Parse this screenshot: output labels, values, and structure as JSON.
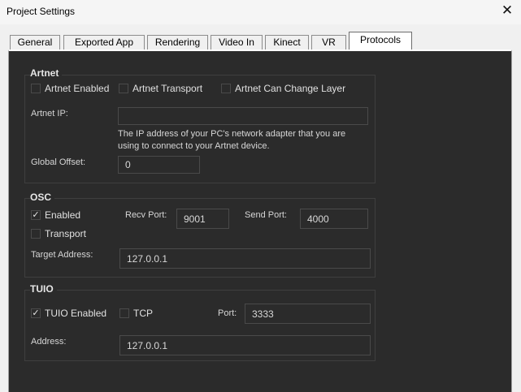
{
  "window": {
    "title": "Project Settings"
  },
  "tabs": [
    {
      "label": "General"
    },
    {
      "label": "Exported App"
    },
    {
      "label": "Rendering"
    },
    {
      "label": "Video In"
    },
    {
      "label": "Kinect"
    },
    {
      "label": "VR"
    },
    {
      "label": "Protocols"
    }
  ],
  "active_tab": "Protocols",
  "artnet": {
    "title": "Artnet",
    "enabled": {
      "label": "Artnet Enabled",
      "checked": false
    },
    "transport": {
      "label": "Artnet Transport",
      "checked": false
    },
    "can_change_layer": {
      "label": "Artnet Can Change Layer",
      "checked": false
    },
    "ip_label": "Artnet IP:",
    "ip_value": "",
    "ip_hint_line1": "The IP address of your PC's network adapter that you are",
    "ip_hint_line2": "using to connect to your Artnet device.",
    "offset_label": "Global Offset:",
    "offset_value": "0"
  },
  "osc": {
    "title": "OSC",
    "enabled": {
      "label": "Enabled",
      "checked": true
    },
    "transport": {
      "label": "Transport",
      "checked": false
    },
    "recv_port_label": "Recv Port:",
    "recv_port_value": "9001",
    "send_port_label": "Send Port:",
    "send_port_value": "4000",
    "target_label": "Target Address:",
    "target_value": "127.0.0.1"
  },
  "tuio": {
    "title": "TUIO",
    "enabled": {
      "label": "TUIO Enabled",
      "checked": true
    },
    "tcp": {
      "label": "TCP",
      "checked": false
    },
    "port_label": "Port:",
    "port_value": "3333",
    "address_label": "Address:",
    "address_value": "127.0.0.1"
  },
  "icons": {
    "close": "✕",
    "check": "✓"
  }
}
